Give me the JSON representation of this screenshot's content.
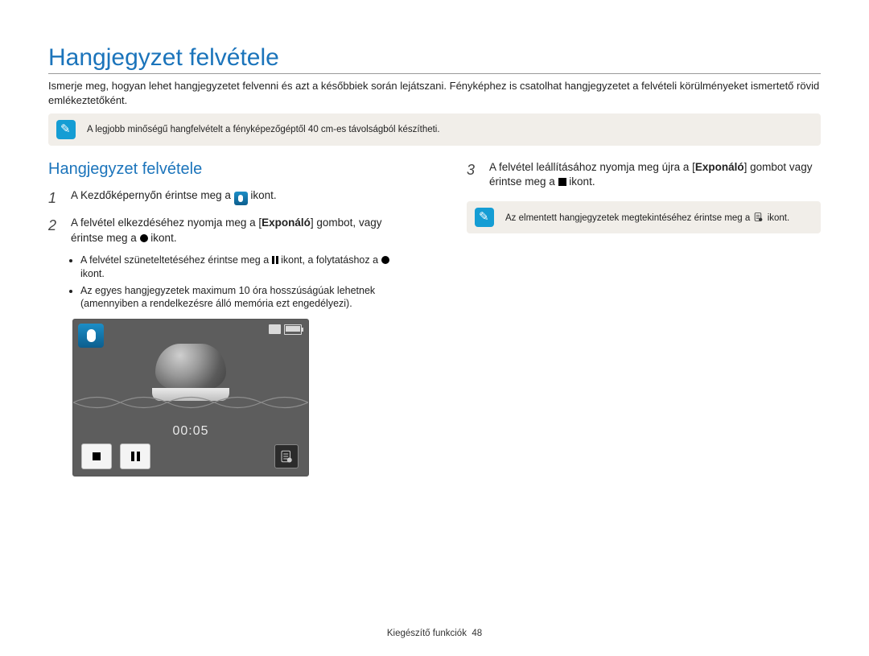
{
  "title": "Hangjegyzet felvétele",
  "intro": "Ismerje meg, hogyan lehet hangjegyzetet felvenni és azt a későbbiek során lejátszani. Fényképhez is csatolhat hangjegyzetet a felvételi körülményeket ismertető rövid emlékeztetőként.",
  "tip1": "A legjobb minőségű hangfelvételt a fényképezőgéptől 40 cm-es távolságból készítheti.",
  "subhead": "Hangjegyzet felvétele",
  "step1_pre": "A Kezdőképernyőn érintse meg a ",
  "step1_post": " ikont.",
  "step2_pre": "A felvétel elkezdéséhez nyomja meg a [",
  "step2_bold": "Exponáló",
  "step2_mid": "] gombot, vagy érintse meg a ",
  "step2_post": " ikont.",
  "bullet1_pre": "A felvétel szüneteltetéséhez érintse meg a ",
  "bullet1_mid": " ikont, a folytatáshoz a ",
  "bullet1_post": " ikont.",
  "bullet2": "Az egyes hangjegyzetek maximum 10 óra hosszúságúak lehetnek (amennyiben a rendelkezésre álló memória ezt engedélyezi).",
  "timer": "00:05",
  "step3_pre": "A felvétel leállításához nyomja meg újra a [",
  "step3_bold": "Exponáló",
  "step3_mid": "] gombot vagy érintse meg a ",
  "step3_post": " ikont.",
  "tip2_pre": "Az elmentett hangjegyzetek megtekintéséhez érintse meg a ",
  "tip2_post": " ikont.",
  "footer_label": "Kiegészítő funkciók",
  "footer_page": "48"
}
